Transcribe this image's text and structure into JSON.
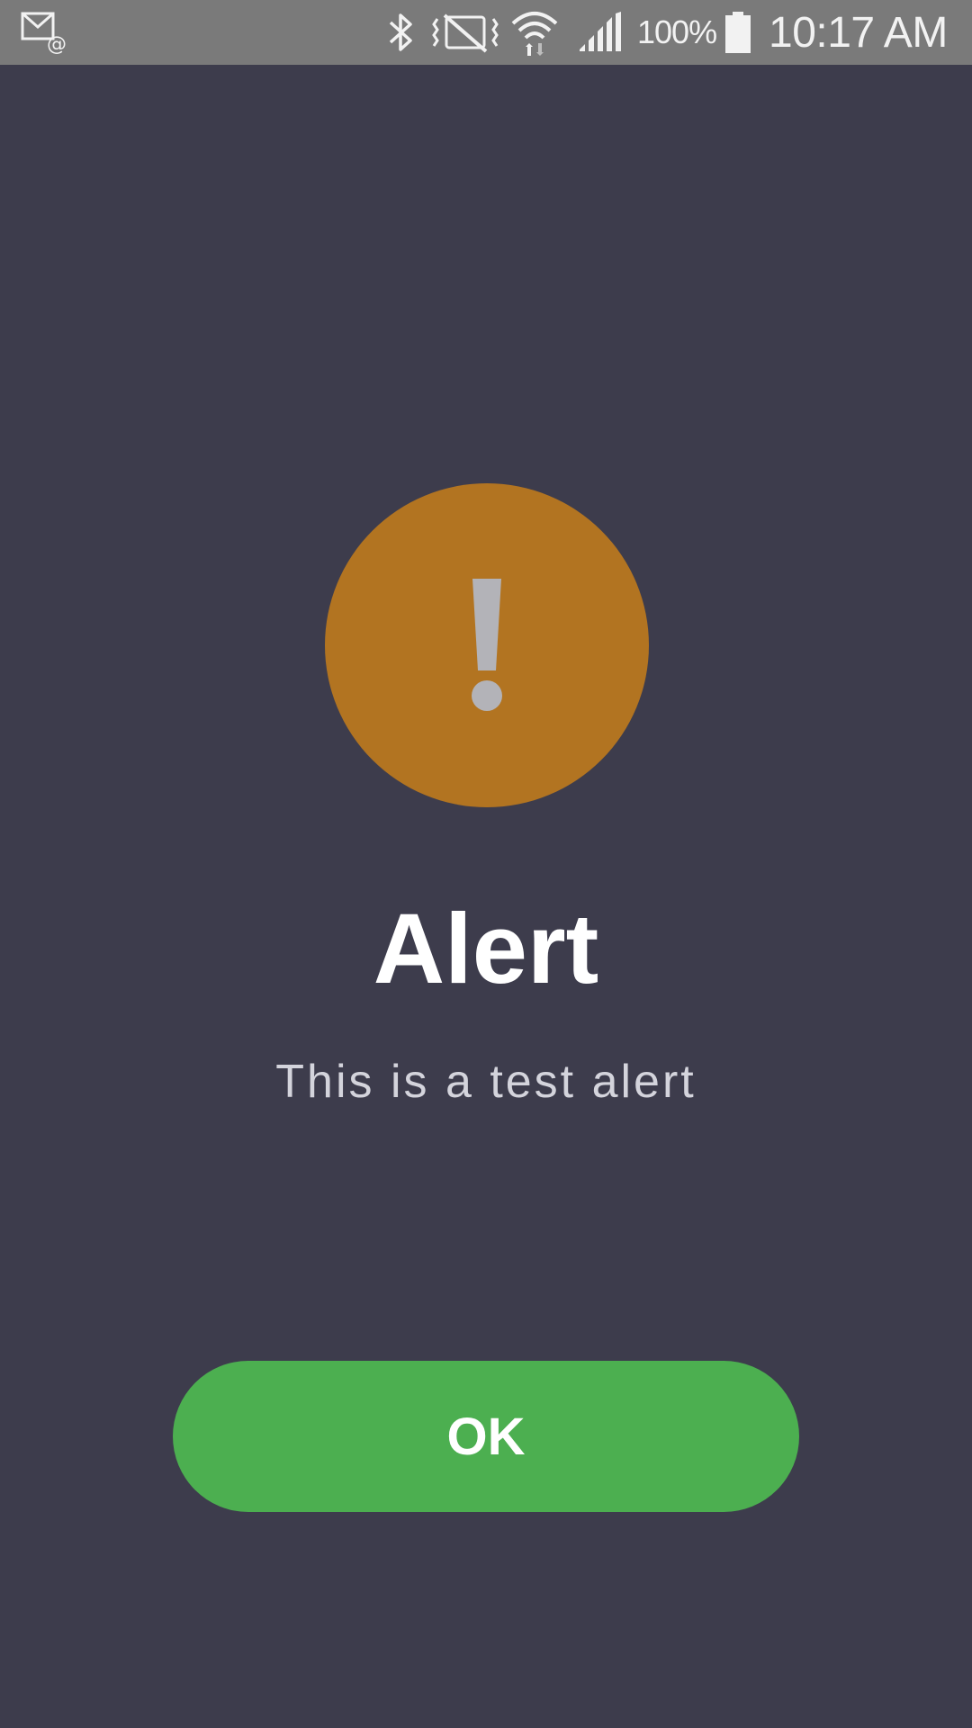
{
  "status_bar": {
    "left_icon": "email-notification-icon",
    "icons": [
      "bluetooth-icon",
      "vibrate-icon",
      "wifi-icon",
      "signal-icon",
      "battery-icon"
    ],
    "battery_percent": "100%",
    "time": "10:17 AM"
  },
  "alert": {
    "icon": "exclamation-icon",
    "icon_color": "#b27421",
    "title": "Alert",
    "message": "This is a test alert",
    "ok_label": "OK",
    "ok_color": "#4caf50"
  },
  "colors": {
    "background": "#3d3c4c",
    "status_bar": "#7a7a7a"
  }
}
